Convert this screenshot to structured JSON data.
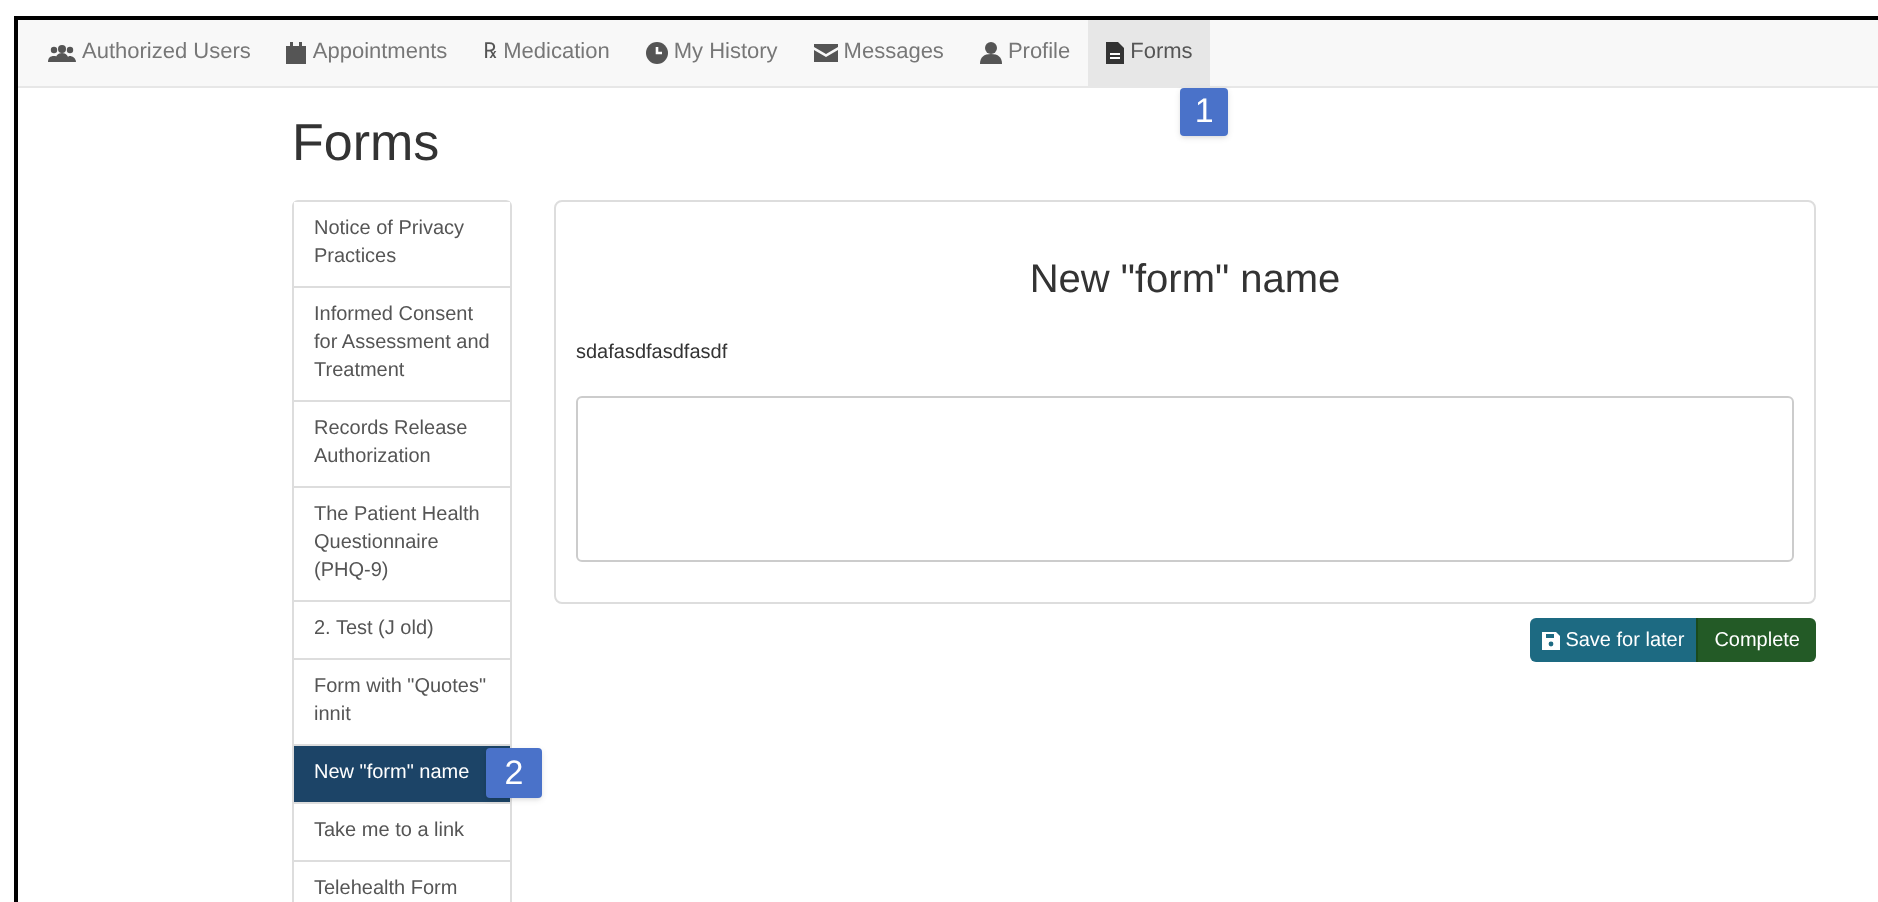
{
  "nav": {
    "items": [
      {
        "label": "Authorized Users",
        "selected": false
      },
      {
        "label": "Appointments",
        "selected": false
      },
      {
        "label": "Medication",
        "glyph": "℞",
        "selected": false
      },
      {
        "label": "My History",
        "selected": false
      },
      {
        "label": "Messages",
        "selected": false
      },
      {
        "label": "Profile",
        "selected": false
      },
      {
        "label": "Forms",
        "selected": true,
        "callout": "1"
      }
    ]
  },
  "page_title": "Forms",
  "sidebar": {
    "items": [
      {
        "label": "Notice of Privacy Practices",
        "selected": false
      },
      {
        "label": "Informed Consent for Assessment and Treatment",
        "selected": false
      },
      {
        "label": "Records Release Authorization",
        "selected": false
      },
      {
        "label": "The Patient Health Questionnaire (PHQ-9)",
        "selected": false
      },
      {
        "label": "2. Test (J old)",
        "selected": false
      },
      {
        "label": "Form with \"Quotes\" innit",
        "selected": false
      },
      {
        "label": "New \"form\" name",
        "selected": true,
        "callout": "2"
      },
      {
        "label": "Take me to a link",
        "selected": false
      },
      {
        "label": "Telehealth Form",
        "selected": false
      }
    ]
  },
  "form": {
    "title": "New \"form\" name",
    "question": "sdafasdfasdfasdf"
  },
  "buttons": [
    {
      "label": "Save for later",
      "kind": "save"
    },
    {
      "label": "Complete",
      "kind": "complete"
    }
  ]
}
